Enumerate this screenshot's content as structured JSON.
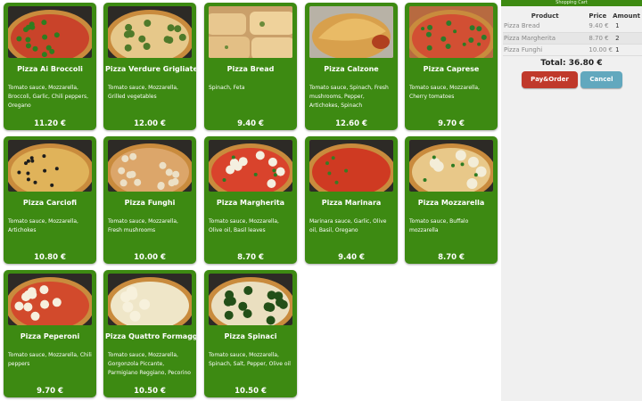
{
  "menu": {
    "pizzas": [
      {
        "name": "Pizza Ai Broccoli",
        "description": "Tomato sauce, Mozzarella, Broccoli, Garlic, Chili peppers, Oregano",
        "price": "11.20 €",
        "image": "broccoli"
      },
      {
        "name": "Pizza Verdure Grigliate",
        "description": "Tomato sauce, Mozzarella, Grilled vegetables",
        "price": "12.00 €",
        "image": "verdure"
      },
      {
        "name": "Pizza Bread",
        "description": "Spinach, Feta",
        "price": "9.40 €",
        "image": "bread"
      },
      {
        "name": "Pizza Calzone",
        "description": "Tomato sauce, Spinach, Fresh mushrooms, Pepper, Artichokes, Spinach",
        "price": "12.60 €",
        "image": "calzone"
      },
      {
        "name": "Pizza Caprese",
        "description": "Tomato sauce, Mozzarella, Cherry tomatoes",
        "price": "9.70 €",
        "image": "caprese"
      },
      {
        "name": "Pizza Carciofi",
        "description": "Tomato sauce, Mozzarella, Artichokes",
        "price": "10.80 €",
        "image": "carciofi"
      },
      {
        "name": "Pizza Funghi",
        "description": "Tomato sauce, Mozzarella, Fresh mushrooms",
        "price": "10.00 €",
        "image": "funghi"
      },
      {
        "name": "Pizza Margherita",
        "description": "Tomato sauce, Mozzarella, Olive oil, Basil leaves",
        "price": "8.70 €",
        "image": "margherita"
      },
      {
        "name": "Pizza Marinara",
        "description": "Marinara sauce, Garlic, Olive oil, Basil, Oregano",
        "price": "9.40 €",
        "image": "marinara"
      },
      {
        "name": "Pizza Mozzarella",
        "description": "Tomato sauce, Buffalo mozzarella",
        "price": "8.70 €",
        "image": "mozzarella"
      },
      {
        "name": "Pizza Peperoni",
        "description": "Tomato sauce, Mozzarella, Chili peppers",
        "price": "9.70 €",
        "image": "peperoni"
      },
      {
        "name": "Pizza Quattro Formaggi",
        "description": "Tomato sauce, Mozzarella, Gorgonzola Piccante, Parmigiano Reggiano, Pecorino",
        "price": "10.50 €",
        "image": "formaggi"
      },
      {
        "name": "Pizza Spinaci",
        "description": "Tomato sauce, Mozzarella, Spinach, Salt, Pepper, Olive oil",
        "price": "10.50 €",
        "image": "spinaci"
      }
    ]
  },
  "cart": {
    "title": "Shopping Cart",
    "columns": {
      "product": "Product",
      "price": "Price",
      "amount": "Amount"
    },
    "items": [
      {
        "product": "Pizza Bread",
        "price": "9.40 €",
        "amount": "1"
      },
      {
        "product": "Pizza Margherita",
        "price": "8.70 €",
        "amount": "2"
      },
      {
        "product": "Pizza Funghi",
        "price": "10.00 €",
        "amount": "1"
      }
    ],
    "total": "Total: 36.80 €",
    "order_label": "Pay&Order",
    "cancel_label": "Cancel"
  },
  "colors": {
    "card": "#3d8a12",
    "order_button": "#c0392b",
    "cancel_button": "#62a8be"
  }
}
